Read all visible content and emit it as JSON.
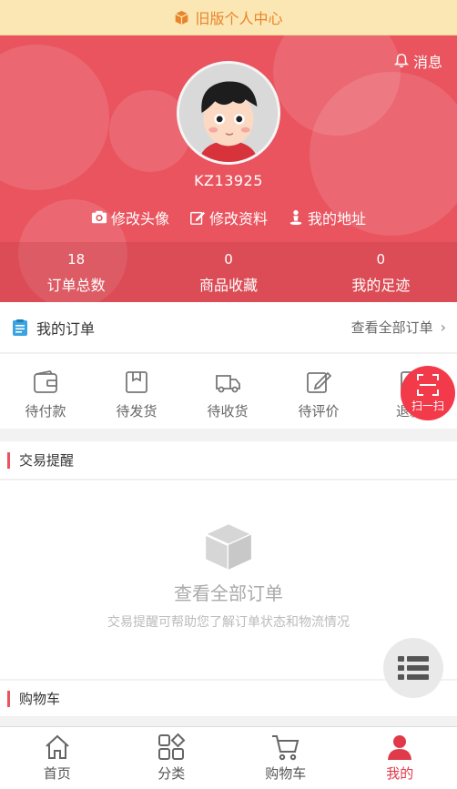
{
  "banner": {
    "label": "旧版个人中心",
    "icon": "cube-icon"
  },
  "header": {
    "message_label": "消息",
    "username": "KZ13925",
    "actions": [
      {
        "label": "修改头像",
        "icon": "camera-icon"
      },
      {
        "label": "修改资料",
        "icon": "edit-icon"
      },
      {
        "label": "我的地址",
        "icon": "location-person-icon"
      }
    ],
    "stats": [
      {
        "value": "18",
        "label": "订单总数"
      },
      {
        "value": "0",
        "label": "商品收藏"
      },
      {
        "value": "0",
        "label": "我的足迹"
      }
    ]
  },
  "orders": {
    "title": "我的订单",
    "view_all": "查看全部订单",
    "tabs": [
      {
        "label": "待付款",
        "icon": "wallet-icon"
      },
      {
        "label": "待发货",
        "icon": "package-icon"
      },
      {
        "label": "待收货",
        "icon": "truck-icon"
      },
      {
        "label": "待评价",
        "icon": "review-edit-icon"
      },
      {
        "label": "退款",
        "icon": "refund-icon"
      }
    ]
  },
  "scan": {
    "label": "扫一扫"
  },
  "reminders": {
    "title": "交易提醒",
    "empty_title": "查看全部订单",
    "empty_sub": "交易提醒可帮助您了解订单状态和物流情况"
  },
  "cart_section": {
    "title": "购物车"
  },
  "tabbar": {
    "items": [
      {
        "label": "首页",
        "icon": "home-icon"
      },
      {
        "label": "分类",
        "icon": "category-icon"
      },
      {
        "label": "购物车",
        "icon": "cart-icon"
      },
      {
        "label": "我的",
        "icon": "user-icon"
      }
    ],
    "active_color": "#e0394a"
  },
  "colors": {
    "brand": "#e9545f",
    "banner_bg": "#fbe7b4",
    "banner_text": "#e8842b"
  }
}
